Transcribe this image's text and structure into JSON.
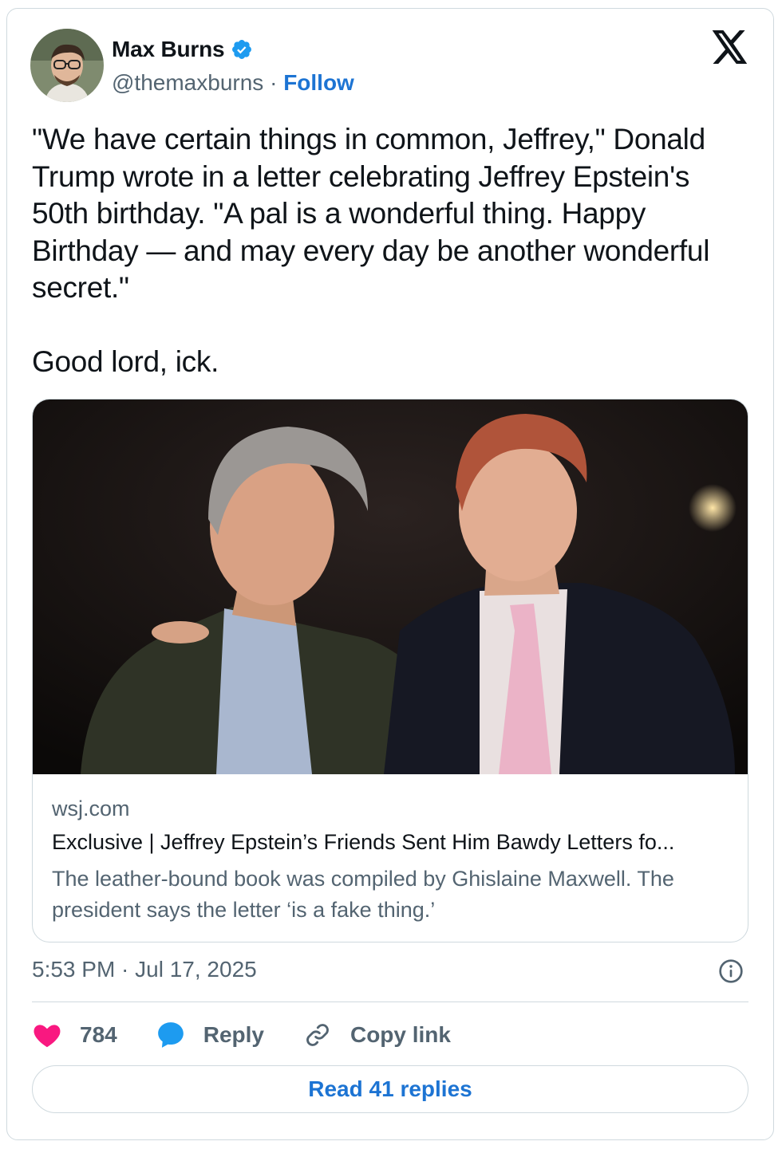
{
  "author": {
    "display_name": "Max Burns",
    "handle": "@themaxburns",
    "separator": " · ",
    "follow_label": "Follow",
    "verified": true
  },
  "tweet": {
    "text": "\"We have certain things in common, Jeffrey,\" Donald\nTrump wrote in a letter celebrating Jeffrey Epstein's\n50th birthday. \"A pal is a wonderful thing. Happy\nBirthday — and may every day be another wonderful\nsecret.\"\n\nGood lord, ick."
  },
  "link_card": {
    "domain": "wsj.com",
    "title": "Exclusive | Jeffrey Epstein’s Friends Sent Him Bawdy Letters fo...",
    "description": "The leather-bound book was compiled by Ghislaine Maxwell. The president says the letter ‘is a fake thing.’"
  },
  "meta": {
    "timestamp": "5:53 PM · Jul 17, 2025"
  },
  "actions": {
    "likes": "784",
    "reply_label": "Reply",
    "copy_link_label": "Copy link"
  },
  "read_replies_label": "Read 41 replies",
  "icons": [
    "x-logo-icon",
    "verified-badge-icon",
    "info-icon",
    "heart-icon",
    "reply-bubble-icon",
    "link-icon"
  ],
  "colors": {
    "accent": "#1d74d3",
    "verified": "#1d9bf0",
    "heart": "#f91880",
    "secondary_text": "#536471",
    "border": "#cfd9de"
  }
}
